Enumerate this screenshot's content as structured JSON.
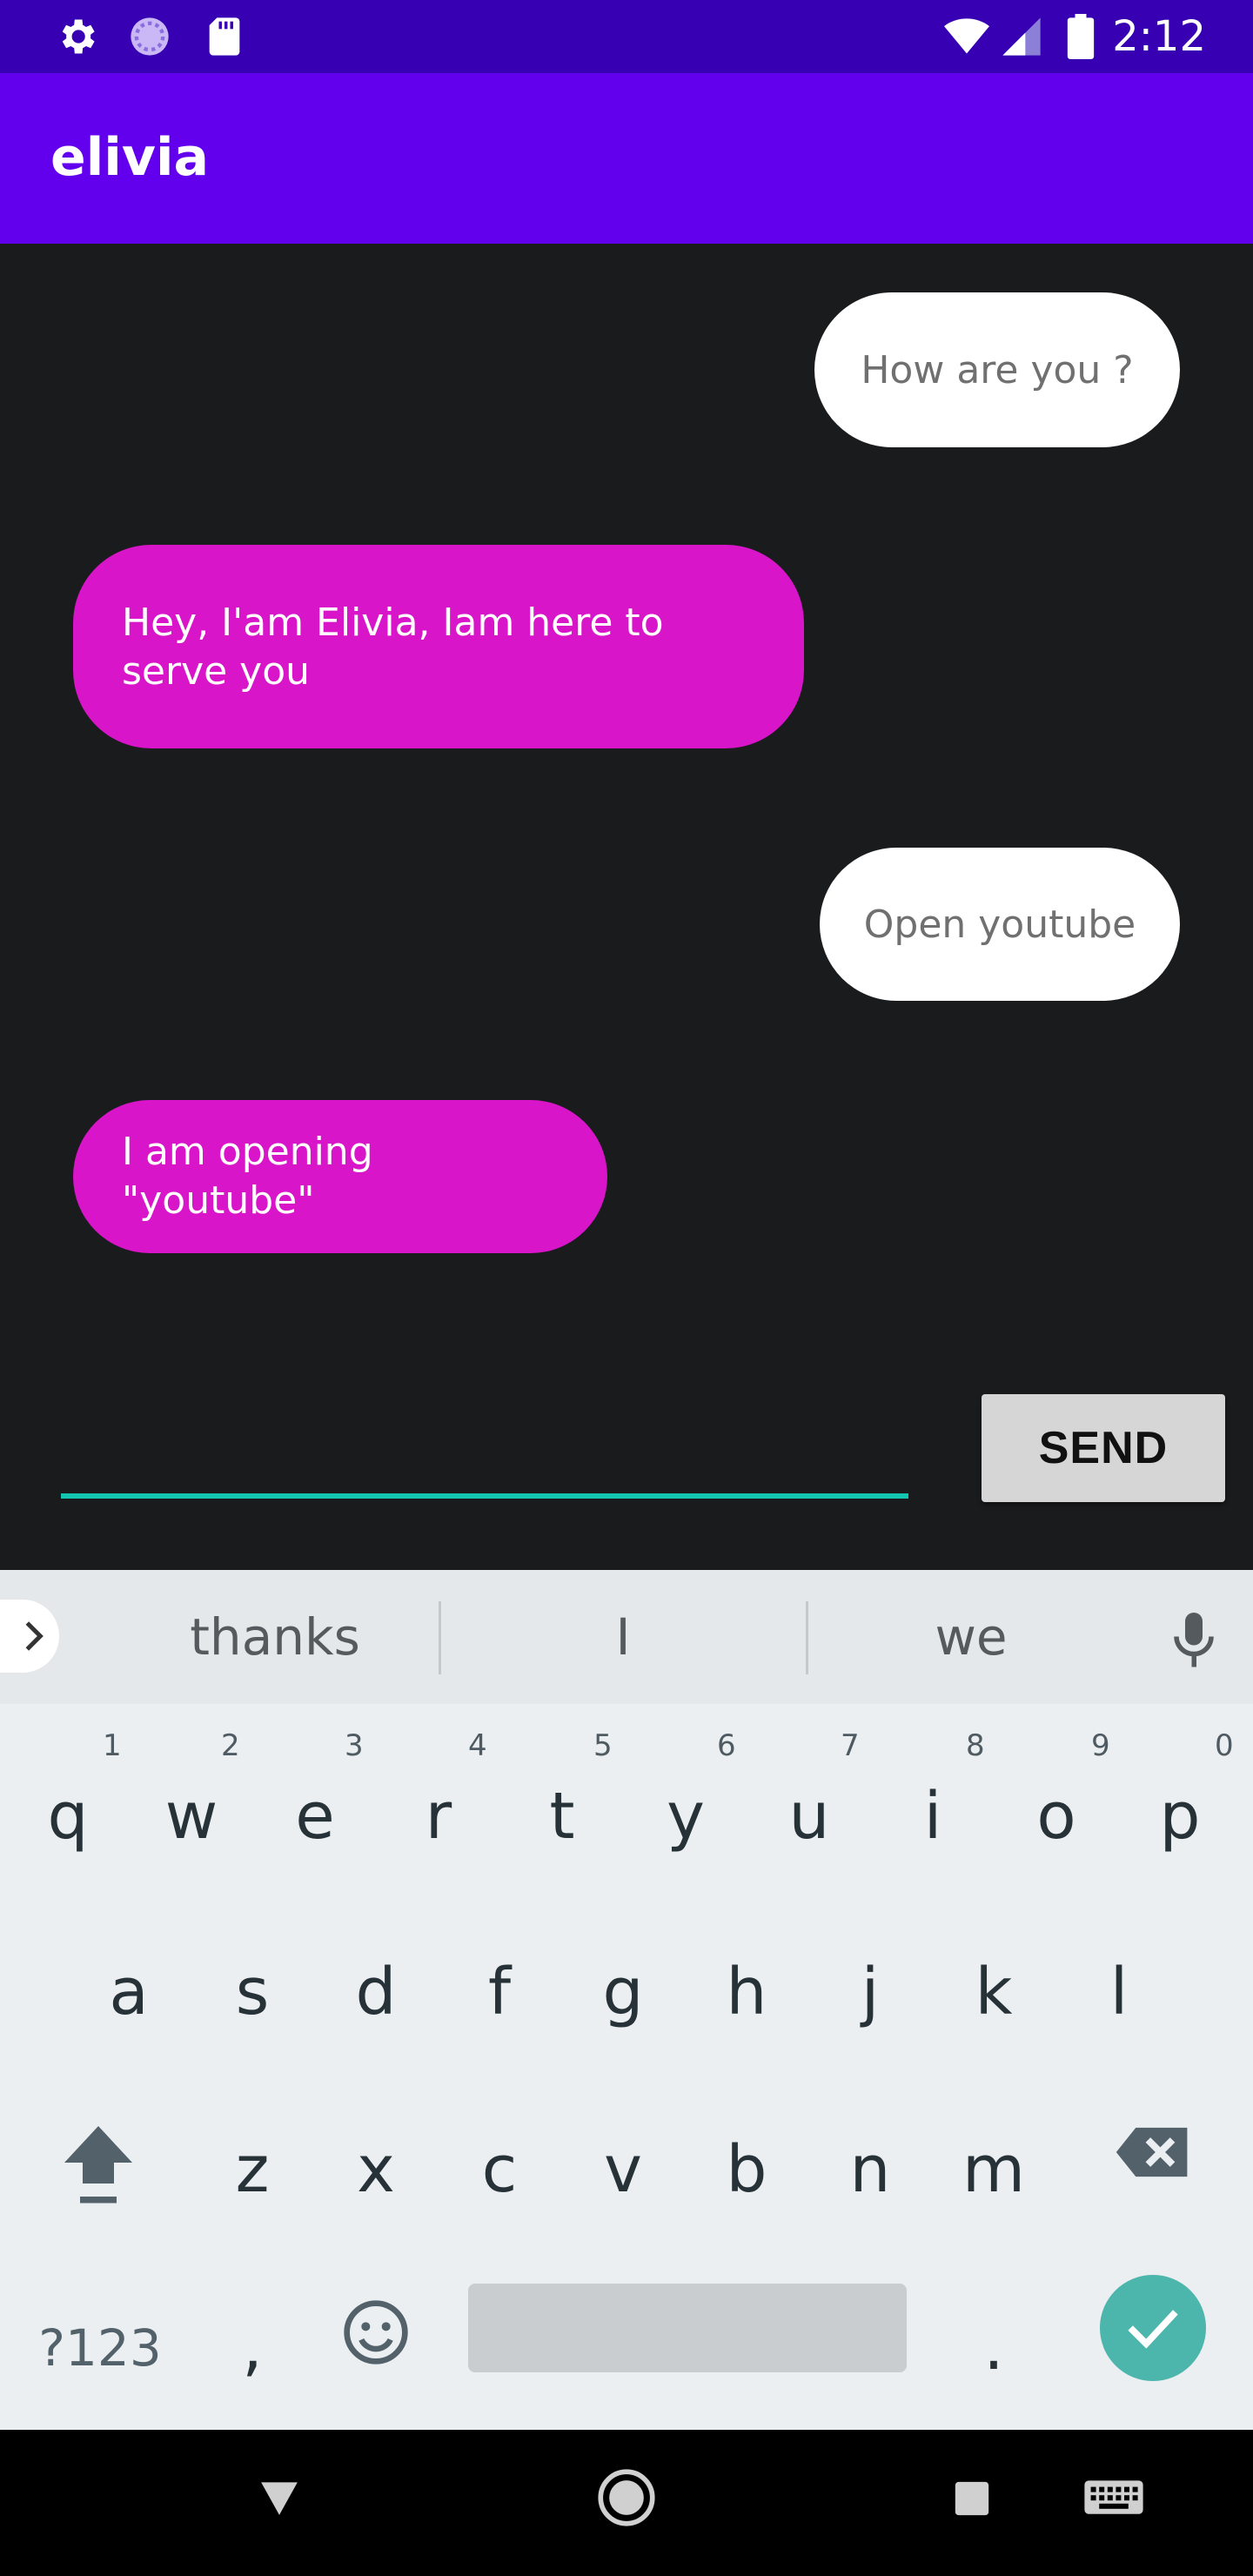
{
  "status_bar": {
    "time": "2:12",
    "icons_left": [
      "settings-icon",
      "sync-icon",
      "sd-card-icon"
    ],
    "icons_right": [
      "wifi-icon",
      "cell-signal-icon",
      "battery-icon"
    ]
  },
  "app_bar": {
    "title": "elivia"
  },
  "chat": {
    "messages": [
      {
        "sender": "user",
        "text": "How are you ?"
      },
      {
        "sender": "bot",
        "text": "Hey, I'am Elivia, Iam here to serve you"
      },
      {
        "sender": "user",
        "text": "Open youtube"
      },
      {
        "sender": "bot",
        "text": "I am opening \"youtube\""
      }
    ]
  },
  "input": {
    "value": "",
    "send_label": "SEND"
  },
  "keyboard": {
    "suggestions": [
      "thanks",
      "I",
      "we"
    ],
    "row1": [
      "q",
      "w",
      "e",
      "r",
      "t",
      "y",
      "u",
      "i",
      "o",
      "p"
    ],
    "row1_hints": [
      "1",
      "2",
      "3",
      "4",
      "5",
      "6",
      "7",
      "8",
      "9",
      "0"
    ],
    "row2": [
      "a",
      "s",
      "d",
      "f",
      "g",
      "h",
      "j",
      "k",
      "l"
    ],
    "row3": [
      "z",
      "x",
      "c",
      "v",
      "b",
      "n",
      "m"
    ],
    "symbols_label": "?123",
    "comma": ",",
    "period": "."
  },
  "colors": {
    "status_bar": "#3700b3",
    "app_bar": "#6200ee",
    "background": "#1a1b1d",
    "bot_bubble": "#d815c8",
    "user_bubble": "#ffffff",
    "accent": "#13c6b2",
    "enter_key": "#4db6ac"
  }
}
